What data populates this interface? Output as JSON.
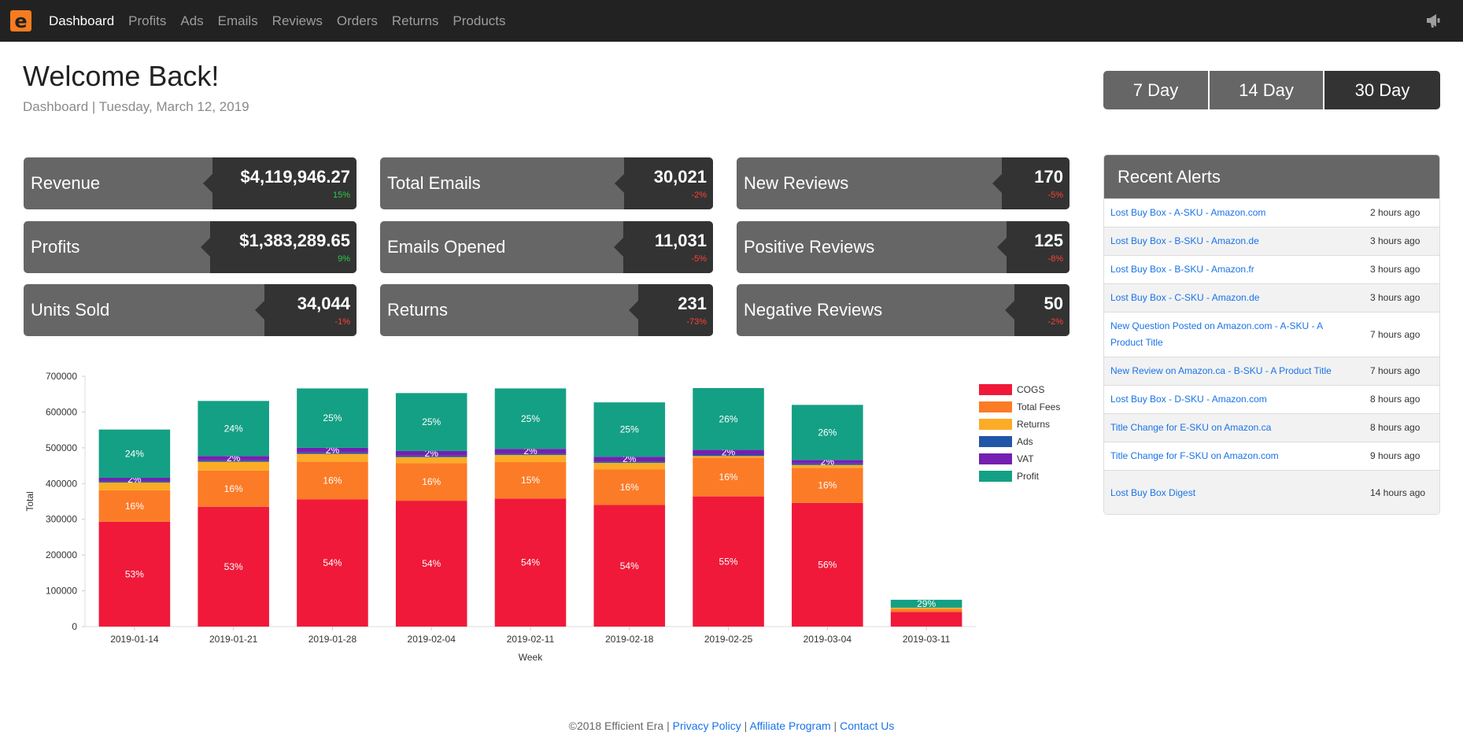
{
  "nav": {
    "items": [
      "Dashboard",
      "Profits",
      "Ads",
      "Emails",
      "Reviews",
      "Orders",
      "Returns",
      "Products"
    ]
  },
  "header": {
    "title": "Welcome Back!",
    "subtitle": "Dashboard | Tuesday, March 12, 2019"
  },
  "day_toggle": {
    "options": [
      "7 Day",
      "14 Day",
      "30 Day"
    ],
    "active": "30 Day"
  },
  "stats": [
    {
      "label": "Revenue",
      "value": "$4,119,946.27",
      "change": "15%",
      "trend": "pos"
    },
    {
      "label": "Total Emails",
      "value": "30,021",
      "change": "-2%",
      "trend": "neg"
    },
    {
      "label": "New Reviews",
      "value": "170",
      "change": "-5%",
      "trend": "neg"
    },
    {
      "label": "Profits",
      "value": "$1,383,289.65",
      "change": "9%",
      "trend": "pos"
    },
    {
      "label": "Emails Opened",
      "value": "11,031",
      "change": "-5%",
      "trend": "neg"
    },
    {
      "label": "Positive Reviews",
      "value": "125",
      "change": "-8%",
      "trend": "neg"
    },
    {
      "label": "Units Sold",
      "value": "34,044",
      "change": "-1%",
      "trend": "neg"
    },
    {
      "label": "Returns",
      "value": "231",
      "change": "-73%",
      "trend": "neg"
    },
    {
      "label": "Negative Reviews",
      "value": "50",
      "change": "-2%",
      "trend": "neg"
    }
  ],
  "alerts": {
    "title": "Recent Alerts",
    "items": [
      {
        "text": "Lost Buy Box - A-SKU - Amazon.com",
        "time": "2 hours ago"
      },
      {
        "text": "Lost Buy Box - B-SKU - Amazon.de",
        "time": "3 hours ago"
      },
      {
        "text": "Lost Buy Box - B-SKU - Amazon.fr",
        "time": "3 hours ago"
      },
      {
        "text": "Lost Buy Box - C-SKU - Amazon.de",
        "time": "3 hours ago"
      },
      {
        "text": "New Question Posted on Amazon.com - A-SKU - A Product Title",
        "time": "7 hours ago"
      },
      {
        "text": "New Review on Amazon.ca - B-SKU - A Product Title",
        "time": "7 hours ago"
      },
      {
        "text": "Lost Buy Box - D-SKU - Amazon.com",
        "time": "8 hours ago"
      },
      {
        "text": "Title Change for E-SKU on Amazon.ca",
        "time": "8 hours ago"
      },
      {
        "text": "Title Change for F-SKU on Amazon.com",
        "time": "9 hours ago"
      },
      {
        "text": "Lost Buy Box Digest",
        "time": "14 hours ago"
      }
    ]
  },
  "colors": {
    "COGS": "#f0193a",
    "Total Fees": "#fc7b27",
    "Returns": "#fcab27",
    "Ads": "#2155a8",
    "VAT": "#7420b0",
    "Profit": "#14a085"
  },
  "chart_data": {
    "type": "bar",
    "stacked": true,
    "xlabel": "Week",
    "ylabel": "Total",
    "ylim": [
      0,
      700000
    ],
    "yticks": [
      0,
      100000,
      200000,
      300000,
      400000,
      500000,
      600000,
      700000
    ],
    "categories": [
      "2019-01-14",
      "2019-01-21",
      "2019-01-28",
      "2019-02-04",
      "2019-02-11",
      "2019-02-18",
      "2019-02-25",
      "2019-03-04",
      "2019-03-11"
    ],
    "legend_position": "right",
    "series": [
      {
        "name": "COGS",
        "values": [
          293000,
          335000,
          356000,
          352000,
          358000,
          340000,
          364000,
          346000,
          41000
        ],
        "labels": [
          "53%",
          "53%",
          "54%",
          "54%",
          "54%",
          "54%",
          "55%",
          "56%",
          ""
        ]
      },
      {
        "name": "Total Fees",
        "values": [
          88000,
          101000,
          105000,
          105000,
          102000,
          100000,
          108000,
          98000,
          8000
        ],
        "labels": [
          "16%",
          "16%",
          "16%",
          "16%",
          "15%",
          "16%",
          "16%",
          "16%",
          ""
        ]
      },
      {
        "name": "Returns",
        "values": [
          22000,
          25000,
          22000,
          17000,
          20000,
          18000,
          5000,
          8000,
          4000
        ],
        "labels": [
          "",
          "",
          "",
          "",
          "",
          "",
          "",
          "",
          ""
        ]
      },
      {
        "name": "Ads",
        "values": [
          4000,
          4000,
          4000,
          4000,
          4000,
          4000,
          4000,
          4000,
          0
        ],
        "labels": [
          "",
          "",
          "",
          "",
          "",
          "",
          "",
          "",
          ""
        ]
      },
      {
        "name": "VAT",
        "values": [
          9000,
          12000,
          13000,
          13000,
          13000,
          13000,
          13000,
          10000,
          0
        ],
        "labels": [
          "2%",
          "2%",
          "2%",
          "2%",
          "2%",
          "2%",
          "2%",
          "2%",
          ""
        ]
      },
      {
        "name": "Profit",
        "values": [
          135000,
          154000,
          166000,
          162000,
          169000,
          152000,
          173000,
          154000,
          22000
        ],
        "labels": [
          "24%",
          "24%",
          "25%",
          "25%",
          "25%",
          "25%",
          "26%",
          "26%",
          "29%"
        ]
      }
    ]
  },
  "footer": {
    "copyright": "©2018 Efficient Era |",
    "links": [
      "Privacy Policy",
      "Affiliate Program",
      "Contact Us"
    ]
  }
}
